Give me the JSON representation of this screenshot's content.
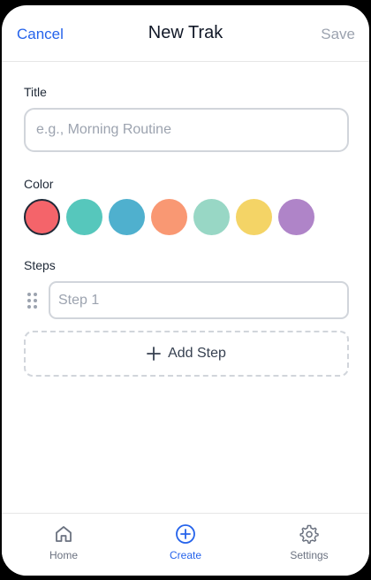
{
  "header": {
    "cancel_label": "Cancel",
    "title": "New Trak",
    "save_label": "Save"
  },
  "form": {
    "title_label": "Title",
    "title_value": "",
    "title_placeholder": "e.g., Morning Routine",
    "color_label": "Color",
    "colors": [
      {
        "hex": "#F4646A",
        "selected": true
      },
      {
        "hex": "#56C7BC",
        "selected": false
      },
      {
        "hex": "#4FB0CE",
        "selected": false
      },
      {
        "hex": "#F99873",
        "selected": false
      },
      {
        "hex": "#98D7C5",
        "selected": false
      },
      {
        "hex": "#F4D466",
        "selected": false
      },
      {
        "hex": "#AF84C8",
        "selected": false
      }
    ],
    "steps_label": "Steps",
    "steps": [
      {
        "value": "",
        "placeholder": "Step 1"
      }
    ],
    "add_step_label": "Add Step"
  },
  "tabbar": {
    "tabs": [
      {
        "label": "Home",
        "icon": "home-icon",
        "active": false
      },
      {
        "label": "Create",
        "icon": "plus-circle-icon",
        "active": true
      },
      {
        "label": "Settings",
        "icon": "gear-icon",
        "active": false
      }
    ]
  },
  "theme": {
    "accent": "#2563EB",
    "muted": "#9CA3AF",
    "border": "#D1D5DB"
  }
}
